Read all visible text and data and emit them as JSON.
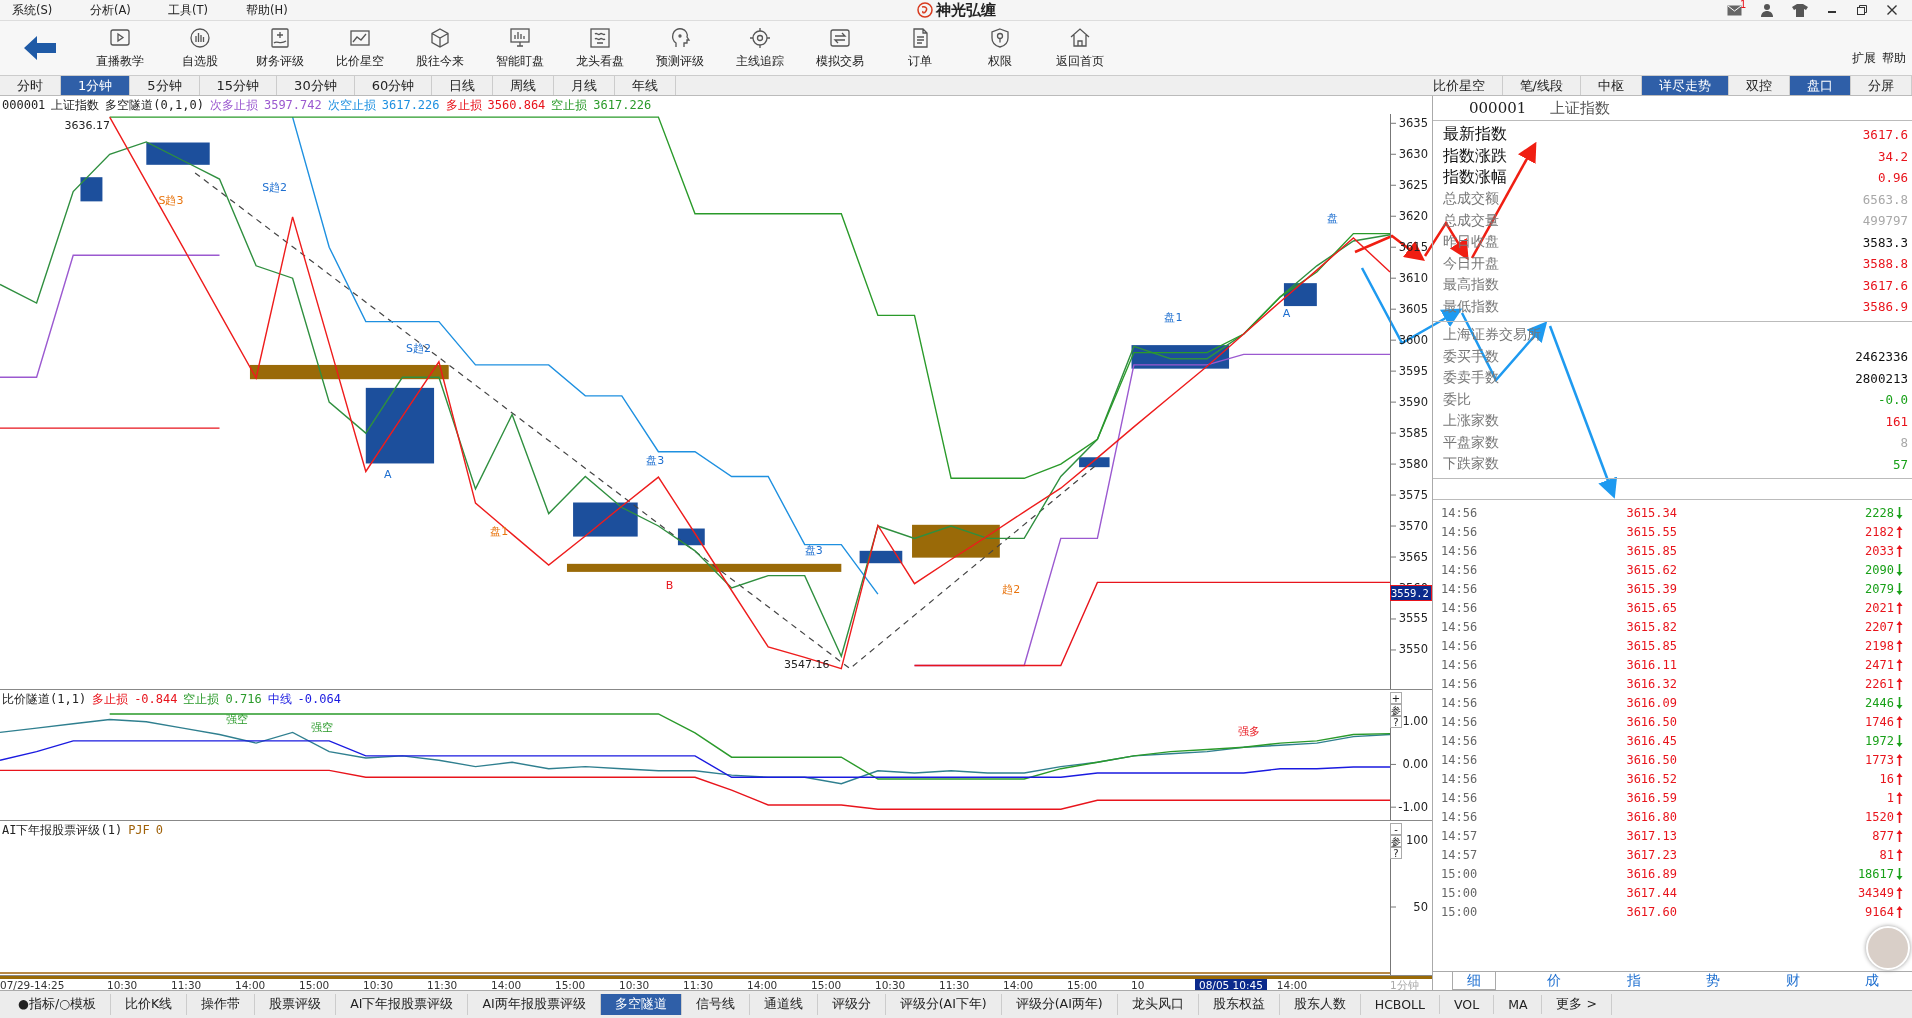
{
  "menu": {
    "items": [
      "系统(S)",
      "分析(A)",
      "工具(T)",
      "帮助(H)"
    ],
    "brand": "神光弘缠",
    "notifications": "1"
  },
  "toolbar": {
    "buttons": [
      "直播教学",
      "自选股",
      "财务评级",
      "比价星空",
      "股往今来",
      "智能盯盘",
      "龙头看盘",
      "预测评级",
      "主线追踪",
      "模拟交易",
      "订单",
      "权限",
      "返回首页"
    ],
    "extra": [
      "扩展",
      "帮助"
    ]
  },
  "period_tabs": [
    {
      "label": "分时",
      "selected": false
    },
    {
      "label": "1分钟",
      "selected": true
    },
    {
      "label": "5分钟",
      "selected": false
    },
    {
      "label": "15分钟",
      "selected": false
    },
    {
      "label": "30分钟",
      "selected": false
    },
    {
      "label": "60分钟",
      "selected": false
    },
    {
      "label": "日线",
      "selected": false
    },
    {
      "label": "周线",
      "selected": false
    },
    {
      "label": "月线",
      "selected": false
    },
    {
      "label": "年线",
      "selected": false
    }
  ],
  "view_tabs": [
    {
      "label": "比价星空",
      "selected": false
    },
    {
      "label": "笔/线段",
      "selected": false
    },
    {
      "label": "中枢",
      "selected": false
    },
    {
      "label": "详尽走势",
      "selected": true
    },
    {
      "label": "双控",
      "selected": false
    },
    {
      "label": "盘口",
      "selected": true
    },
    {
      "label": "分屏",
      "selected": false
    }
  ],
  "main_chart": {
    "code": "000001",
    "indicator": "多空隧道(0,1,0)",
    "legend": [
      "3597.742",
      "3617.226",
      "3560.864",
      "3617.226"
    ],
    "cursor_price": "3559.2",
    "chart_data": {
      "type": "line",
      "categories": [
        null,
        null,
        null,
        null,
        null,
        null,
        null,
        null,
        null,
        null,
        null,
        null,
        null,
        null,
        null,
        null,
        null,
        null,
        null,
        null,
        null,
        null,
        null,
        null,
        null,
        null,
        null,
        null,
        null,
        null,
        null,
        null,
        null,
        null,
        null,
        null,
        null,
        null,
        null
      ],
      "ylim": [
        3543.7,
        3636.5
      ],
      "yticks": [
        3550,
        3555,
        3560,
        3565,
        3570,
        3575,
        3580,
        3585,
        3590,
        3595,
        3600,
        3605,
        3610,
        3615,
        3620,
        3625,
        3630,
        3635
      ],
      "series": [
        {
          "name": "上证指数",
          "color": "#2f8f3f",
          "values": [
            3609,
            3606,
            3624,
            3630,
            3632,
            3629,
            3626,
            3612,
            3610,
            3590,
            3585,
            3594,
            3594,
            3576,
            3588,
            3572,
            3578,
            3573,
            3570,
            3566,
            3560,
            3562,
            3562,
            3549,
            3570,
            3568,
            3570,
            3568,
            3568,
            3578,
            3584,
            3599,
            3597,
            3597,
            3601,
            3607,
            3612,
            3616,
            3617
          ]
        },
        {
          "name": "次多止损",
          "color": "#9b59d0",
          "values": [
            3594,
            3594,
            3613.7,
            3613.7,
            3613.7,
            3613.7,
            3613.7,
            null,
            null,
            null,
            null,
            null,
            null,
            null,
            null,
            null,
            null,
            null,
            null,
            null,
            null,
            null,
            null,
            null,
            null,
            3547.5,
            3547.5,
            3547.5,
            3547.5,
            3568,
            3568,
            3596,
            3596,
            3596,
            3597.7,
            3597.7,
            3597.7,
            3597.7,
            3597.7
          ]
        },
        {
          "name": "次空止损",
          "color": "#1e90e0",
          "values": [
            null,
            null,
            null,
            null,
            null,
            null,
            null,
            null,
            3636,
            3615,
            3603,
            3603,
            3603,
            3596,
            3596,
            3596,
            3591,
            3591,
            3582,
            3582,
            3578,
            3578,
            3567,
            3567,
            3559,
            null,
            null,
            null,
            null,
            null,
            null,
            null,
            null,
            null,
            null,
            null,
            null,
            null,
            null
          ]
        },
        {
          "name": "多止损",
          "color": "#e8141c",
          "values": [
            3585.8,
            3585.8,
            3585.8,
            3585.8,
            3585.8,
            3585.8,
            3585.8,
            null,
            null,
            null,
            null,
            null,
            null,
            null,
            null,
            null,
            null,
            null,
            null,
            null,
            null,
            null,
            null,
            null,
            null,
            3547.5,
            3547.5,
            3547.5,
            3547.5,
            3547.5,
            3560.9,
            3560.9,
            3560.9,
            3560.9,
            3560.9,
            3560.9,
            3560.9,
            3560.9,
            3560.9
          ]
        },
        {
          "name": "空止损",
          "color": "#2a9a2a",
          "values": [
            null,
            null,
            null,
            3636,
            3636,
            3636,
            3636,
            3636,
            3636,
            3636,
            3636,
            3636,
            3636,
            3636,
            3636,
            3636,
            3636,
            3636,
            3636,
            3620.4,
            3620.4,
            3620.4,
            3620.4,
            3620.4,
            3604,
            3604,
            3577.7,
            3577.7,
            3577.7,
            3580,
            3584,
            3598,
            3598,
            3598,
            3601,
            3607,
            3611,
            3617.2,
            3617.2
          ]
        },
        {
          "color": "#ee1c1c",
          "values": [
            null,
            null,
            null,
            3636,
            3625.5,
            3615,
            3604.4,
            3593.9,
            3619.9,
            3599.4,
            3578.8,
            3587.7,
            3596.5,
            3573.7,
            3568.7,
            3563.7,
            3568.4,
            3573.2,
            3577.9,
            3568.8,
            3559.6,
            3550.5,
            3548.8,
            3547,
            3570.1,
            3560.7,
            3564.6,
            3568.4,
            3572.3,
            3576.1,
            3581,
            3586,
            3590.9,
            3595.8,
            3601,
            3606.2,
            3611.3,
            3616.5,
            3611
          ]
        }
      ],
      "annotations": [
        "3636.17",
        "3547.16",
        "S趋3",
        "S趋2",
        "S趋2",
        "A",
        "盘1",
        "盘3",
        "B",
        "盘3",
        "趋2",
        "盘1",
        "A",
        "盘"
      ]
    }
  },
  "ratio_panel": {
    "indicator": "比价隧道(1,1)",
    "legend": [
      "-0.844",
      "0.716",
      "-0.064"
    ],
    "side_buttons": [
      "+",
      "参",
      "?"
    ],
    "chart_data": {
      "type": "line",
      "categories": [
        null,
        null,
        null,
        null,
        null,
        null,
        null,
        null,
        null,
        null,
        null,
        null,
        null,
        null,
        null,
        null,
        null,
        null,
        null,
        null,
        null,
        null,
        null,
        null,
        null,
        null,
        null,
        null,
        null,
        null,
        null,
        null,
        null,
        null,
        null,
        null,
        null,
        null,
        null
      ],
      "ylim": [
        -1.3,
        1.32
      ],
      "yticks": [
        {
          "value": 1,
          "label": "1.00"
        },
        {
          "value": 0,
          "label": "0.00"
        },
        {
          "value": -1,
          "label": "-1.00"
        }
      ],
      "series": [
        {
          "color": "#2f7f8f",
          "values": [
            0.75,
            0.85,
            0.95,
            1.05,
            1.0,
            0.85,
            0.7,
            0.5,
            0.75,
            0.3,
            0.15,
            0.2,
            0.1,
            -0.05,
            0.05,
            -0.1,
            -0.05,
            -0.1,
            -0.15,
            -0.15,
            -0.25,
            -0.3,
            -0.3,
            -0.45,
            -0.15,
            -0.2,
            -0.15,
            -0.2,
            -0.2,
            -0.05,
            0.05,
            0.2,
            0.25,
            0.3,
            0.4,
            0.45,
            0.5,
            0.65,
            0.7
          ]
        },
        {
          "name": "多止损",
          "color": "#e8141c",
          "values": [
            -0.14,
            -0.14,
            -0.14,
            -0.14,
            -0.14,
            -0.14,
            -0.14,
            -0.14,
            -0.14,
            -0.14,
            -0.3,
            -0.3,
            -0.3,
            -0.3,
            -0.3,
            -0.3,
            -0.3,
            -0.3,
            -0.3,
            -0.3,
            -0.6,
            -0.95,
            -0.95,
            -0.95,
            -1.05,
            -1.05,
            -1.05,
            -1.05,
            -1.05,
            -1.05,
            -0.84,
            -0.84,
            -0.84,
            -0.84,
            -0.84,
            -0.84,
            -0.84,
            -0.84,
            -0.84
          ]
        },
        {
          "name": "空止损",
          "color": "#2a9a2a",
          "values": [
            null,
            null,
            null,
            1.18,
            1.18,
            1.18,
            1.18,
            1.18,
            1.18,
            1.18,
            1.18,
            1.18,
            1.18,
            1.18,
            1.18,
            1.18,
            1.18,
            1.18,
            1.18,
            0.74,
            0.17,
            0.17,
            0.17,
            0.17,
            -0.34,
            -0.34,
            -0.34,
            -0.34,
            -0.34,
            -0.1,
            0.05,
            0.2,
            0.3,
            0.35,
            0.4,
            0.5,
            0.55,
            0.7,
            0.72
          ]
        },
        {
          "name": "中线",
          "color": "#1a1ae0",
          "values": [
            0.1,
            0.3,
            0.55,
            0.55,
            0.55,
            0.55,
            0.55,
            0.55,
            0.55,
            0.55,
            0.2,
            0.2,
            0.2,
            0.2,
            0.2,
            0.2,
            0.2,
            0.2,
            0.2,
            0.2,
            -0.3,
            -0.3,
            -0.3,
            -0.3,
            -0.3,
            -0.3,
            -0.3,
            -0.3,
            -0.3,
            -0.3,
            -0.2,
            -0.2,
            -0.2,
            -0.2,
            -0.2,
            -0.1,
            -0.1,
            -0.06,
            -0.06
          ]
        }
      ],
      "annotations": [
        "强空",
        "强空",
        "强多"
      ]
    }
  },
  "rating_panel": {
    "indicator": "AI下年报股票评级(1)",
    "legend": [
      "0"
    ],
    "side_buttons": [
      "-",
      "参",
      "?"
    ],
    "chart_data": {
      "type": "line",
      "categories": [
        null,
        null,
        null,
        null,
        null,
        null,
        null,
        null,
        null,
        null,
        null,
        null,
        null,
        null,
        null,
        null,
        null,
        null,
        null,
        null,
        null,
        null,
        null,
        null,
        null,
        null,
        null,
        null,
        null,
        null,
        null,
        null,
        null,
        null,
        null,
        null,
        null,
        null,
        null
      ],
      "ylim": [
        -1.5,
        101.5
      ],
      "yticks": [
        {
          "value": 100,
          "label": "100"
        },
        {
          "value": 50,
          "label": "50"
        }
      ],
      "series": [
        {
          "name": "PJF",
          "color": "#a0620a",
          "values": [
            0,
            0,
            0,
            0,
            0,
            0,
            0,
            0,
            0,
            0,
            0,
            0,
            0,
            0,
            0,
            0,
            0,
            0,
            0,
            0,
            0,
            0,
            0,
            0,
            0,
            0,
            0,
            0,
            0,
            0,
            0,
            0,
            0,
            0,
            0,
            0,
            0,
            0,
            0
          ]
        }
      ]
    }
  },
  "time_axis": {
    "labels": [
      {
        "text": "07/29-14:25",
        "selected": false
      },
      {
        "text": "10:30",
        "selected": false
      },
      {
        "text": "11:30",
        "selected": false
      },
      {
        "text": "14:00",
        "selected": false
      },
      {
        "text": "15:00",
        "selected": false
      },
      {
        "text": "10:30",
        "selected": false
      },
      {
        "text": "11:30",
        "selected": false
      },
      {
        "text": "14:00",
        "selected": false
      },
      {
        "text": "15:00",
        "selected": false
      },
      {
        "text": "10:30",
        "selected": false
      },
      {
        "text": "11:30",
        "selected": false
      },
      {
        "text": "14:00",
        "selected": false
      },
      {
        "text": "15:00",
        "selected": false
      },
      {
        "text": "10:30",
        "selected": false
      },
      {
        "text": "11:30",
        "selected": false
      },
      {
        "text": "14:00",
        "selected": false
      },
      {
        "text": "15:00",
        "selected": false
      },
      {
        "text": "10",
        "selected": false
      },
      {
        "text": "08/05 10:45",
        "selected": true
      },
      {
        "text": "14:00",
        "selected": false
      }
    ],
    "period": "1分钟"
  },
  "quote_panel": {
    "code": "000001",
    "name": "上证指数",
    "stats": [
      {
        "label": "最新指数",
        "value": "3617.6",
        "kind": "major",
        "color": "#e8141c"
      },
      {
        "label": "指数涨跌",
        "value": "34.2",
        "kind": "major",
        "color": "#e8141c"
      },
      {
        "label": "指数涨幅",
        "value": "0.96",
        "kind": "major",
        "color": "#e8141c"
      },
      {
        "label": "总成交额",
        "value": "6563.8",
        "kind": "minor",
        "color": "#a8a8a8"
      },
      {
        "label": "总成交量",
        "value": "499797",
        "kind": "minor",
        "color": "#a8a8a8"
      },
      {
        "label": "昨日收盘",
        "value": "3583.3",
        "kind": "minor",
        "color": "#111111"
      },
      {
        "label": "今日开盘",
        "value": "3588.8",
        "kind": "minor",
        "color": "#e8141c"
      },
      {
        "label": "最高指数",
        "value": "3617.6",
        "kind": "minor",
        "color": "#e8141c"
      },
      {
        "label": "最低指数",
        "value": "3586.9",
        "kind": "minor",
        "color": "#e8141c"
      }
    ],
    "exchange": "上海证券交易所",
    "exchange_stats": [
      {
        "label": "委买手数",
        "value": "2462336",
        "color": "#111111"
      },
      {
        "label": "委卖手数",
        "value": "2800213",
        "color": "#111111"
      },
      {
        "label": "委比",
        "value": "-0.0",
        "color": "#18a018"
      },
      {
        "label": "上涨家数",
        "value": "161",
        "color": "#e8141c"
      },
      {
        "label": "平盘家数",
        "value": "8",
        "color": "#a8a8a8"
      },
      {
        "label": "下跌家数",
        "value": "57",
        "color": "#18a018"
      }
    ],
    "ticks": [
      {
        "time": "14:56",
        "price": "3615.34",
        "volume": "2228",
        "up": false
      },
      {
        "time": "14:56",
        "price": "3615.55",
        "volume": "2182",
        "up": true
      },
      {
        "time": "14:56",
        "price": "3615.85",
        "volume": "2033",
        "up": true
      },
      {
        "time": "14:56",
        "price": "3615.62",
        "volume": "2090",
        "up": false
      },
      {
        "time": "14:56",
        "price": "3615.39",
        "volume": "2079",
        "up": false
      },
      {
        "time": "14:56",
        "price": "3615.65",
        "volume": "2021",
        "up": true
      },
      {
        "time": "14:56",
        "price": "3615.82",
        "volume": "2207",
        "up": true
      },
      {
        "time": "14:56",
        "price": "3615.85",
        "volume": "2198",
        "up": true
      },
      {
        "time": "14:56",
        "price": "3616.11",
        "volume": "2471",
        "up": true
      },
      {
        "time": "14:56",
        "price": "3616.32",
        "volume": "2261",
        "up": true
      },
      {
        "time": "14:56",
        "price": "3616.09",
        "volume": "2446",
        "up": false
      },
      {
        "time": "14:56",
        "price": "3616.50",
        "volume": "1746",
        "up": true
      },
      {
        "time": "14:56",
        "price": "3616.45",
        "volume": "1972",
        "up": false
      },
      {
        "time": "14:56",
        "price": "3616.50",
        "volume": "1773",
        "up": true
      },
      {
        "time": "14:56",
        "price": "3616.52",
        "volume": "16",
        "up": true
      },
      {
        "time": "14:56",
        "price": "3616.59",
        "volume": "1",
        "up": true
      },
      {
        "time": "14:56",
        "price": "3616.80",
        "volume": "1520",
        "up": true
      },
      {
        "time": "14:57",
        "price": "3617.13",
        "volume": "877",
        "up": true
      },
      {
        "time": "14:57",
        "price": "3617.23",
        "volume": "81",
        "up": true
      },
      {
        "time": "15:00",
        "price": "3616.89",
        "volume": "18617",
        "up": false
      },
      {
        "time": "15:00",
        "price": "3617.44",
        "volume": "34349",
        "up": true
      },
      {
        "time": "15:00",
        "price": "3617.60",
        "volume": "9164",
        "up": true
      }
    ],
    "tabs": [
      {
        "label": "细",
        "selected": true
      },
      {
        "label": "价",
        "selected": false
      },
      {
        "label": "指",
        "selected": false
      },
      {
        "label": "势",
        "selected": false
      },
      {
        "label": "财",
        "selected": false
      },
      {
        "label": "成",
        "selected": false
      }
    ]
  },
  "indicator_tabs": [
    {
      "label": "●指标/○模板",
      "selected": false
    },
    {
      "label": "比价K线",
      "selected": false
    },
    {
      "label": "操作带",
      "selected": false
    },
    {
      "label": "股票评级",
      "selected": false
    },
    {
      "label": "AI下年报股票评级",
      "selected": false
    },
    {
      "label": "AI两年报股票评级",
      "selected": false
    },
    {
      "label": "多空隧道",
      "selected": true
    },
    {
      "label": "信号线",
      "selected": false
    },
    {
      "label": "通道线",
      "selected": false
    },
    {
      "label": "评级分",
      "selected": false
    },
    {
      "label": "评级分(AI下年)",
      "selected": false
    },
    {
      "label": "评级分(AI两年)",
      "selected": false
    },
    {
      "label": "龙头风口",
      "selected": false
    },
    {
      "label": "股东权益",
      "selected": false
    },
    {
      "label": "股东人数",
      "selected": false
    },
    {
      "label": "HCBOLL",
      "selected": false
    },
    {
      "label": "VOL",
      "selected": false
    },
    {
      "label": "MA",
      "selected": false
    },
    {
      "label": "更多 >",
      "selected": false
    }
  ]
}
